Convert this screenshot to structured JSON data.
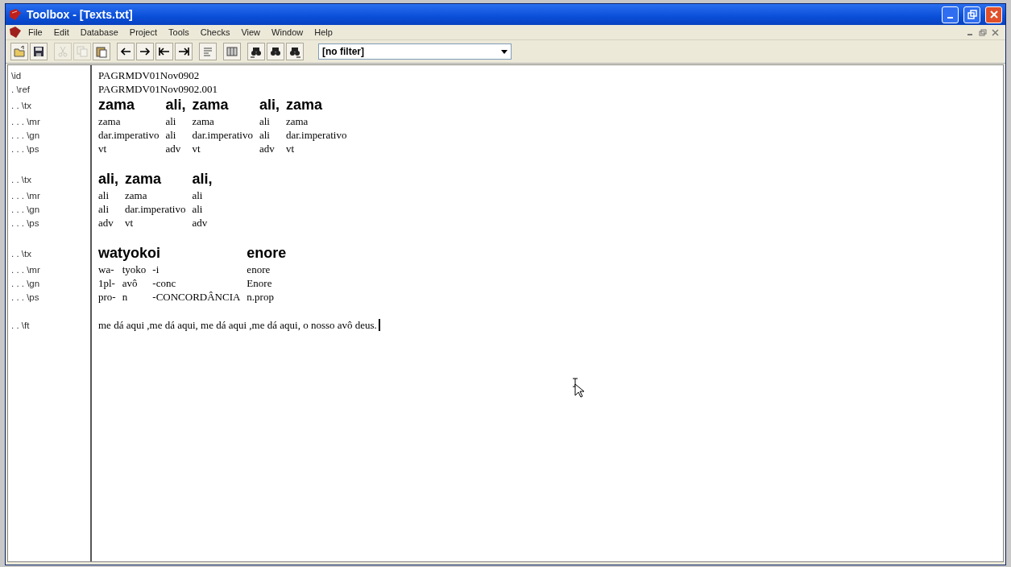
{
  "window": {
    "title": "Toolbox - [Texts.txt]"
  },
  "menu": [
    "File",
    "Edit",
    "Database",
    "Project",
    "Tools",
    "Checks",
    "View",
    "Window",
    "Help"
  ],
  "toolbar": [
    [
      {
        "kind": "open",
        "disabled": false
      },
      {
        "kind": "save",
        "disabled": false
      }
    ],
    [
      {
        "kind": "cut",
        "disabled": true
      },
      {
        "kind": "copy",
        "disabled": true
      },
      {
        "kind": "paste",
        "disabled": false
      }
    ],
    [
      {
        "kind": "prev",
        "disabled": false
      },
      {
        "kind": "next",
        "disabled": false
      },
      {
        "kind": "first",
        "disabled": false
      },
      {
        "kind": "last",
        "disabled": false
      }
    ],
    [
      {
        "kind": "wrap",
        "disabled": false
      }
    ],
    [
      {
        "kind": "columns",
        "disabled": false
      }
    ],
    [
      {
        "kind": "find-prev",
        "disabled": false
      },
      {
        "kind": "find",
        "disabled": false
      },
      {
        "kind": "find-next",
        "disabled": false
      }
    ]
  ],
  "filter": {
    "value": "[no filter]"
  },
  "record": [
    {
      "kind": "line",
      "marker": "\\id",
      "text": "PAGRMDV01Nov0902"
    },
    {
      "kind": "line",
      "marker": ". \\ref",
      "text": "PAGRMDV01Nov0902.001"
    },
    {
      "kind": "interlinear",
      "markers": [
        ". . \\tx",
        ". . . \\mr",
        ". . . \\gn",
        ". . . \\ps"
      ],
      "words": [
        {
          "tx": "zama",
          "morphemes": [
            {
              "mr": "zama",
              "gn": "dar.imperativo",
              "ps": "vt"
            }
          ]
        },
        {
          "tx": "ali,",
          "morphemes": [
            {
              "mr": "ali",
              "gn": "ali",
              "ps": "adv"
            }
          ]
        },
        {
          "tx": "zama",
          "morphemes": [
            {
              "mr": "zama",
              "gn": "dar.imperativo",
              "ps": "vt"
            }
          ]
        },
        {
          "tx": "ali,",
          "morphemes": [
            {
              "mr": "ali",
              "gn": "ali",
              "ps": "adv"
            }
          ]
        },
        {
          "tx": "zama",
          "morphemes": [
            {
              "mr": "zama",
              "gn": "dar.imperativo",
              "ps": "vt"
            }
          ]
        }
      ]
    },
    {
      "kind": "interlinear",
      "markers": [
        ". . \\tx",
        ". . . \\mr",
        ". . . \\gn",
        ". . . \\ps"
      ],
      "words": [
        {
          "tx": "ali,",
          "morphemes": [
            {
              "mr": "ali",
              "gn": "ali",
              "ps": "adv"
            }
          ]
        },
        {
          "tx": "zama",
          "morphemes": [
            {
              "mr": "zama",
              "gn": "dar.imperativo",
              "ps": "vt"
            }
          ]
        },
        {
          "tx": "ali,",
          "morphemes": [
            {
              "mr": "ali",
              "gn": "ali",
              "ps": "adv"
            }
          ]
        }
      ]
    },
    {
      "kind": "interlinear",
      "markers": [
        ". . \\tx",
        ". . . \\mr",
        ". . . \\gn",
        ". . . \\ps"
      ],
      "words": [
        {
          "tx": "watyokoi",
          "morphemes": [
            {
              "mr": "wa-",
              "gn": "1pl-",
              "ps": "pro-"
            },
            {
              "mr": "tyoko",
              "gn": "avô",
              "ps": "n"
            },
            {
              "mr": "-i",
              "gn": "-conc",
              "ps": "-CONCORDÂNCIA"
            }
          ]
        },
        {
          "tx": "enore",
          "morphemes": [
            {
              "mr": "enore",
              "gn": "Enore",
              "ps": "n.prop"
            }
          ]
        }
      ]
    },
    {
      "kind": "free",
      "marker": ". . \\ft",
      "text": "me dá aqui ,me dá aqui, me dá aqui ,me dá aqui, o nosso avô deus."
    }
  ]
}
